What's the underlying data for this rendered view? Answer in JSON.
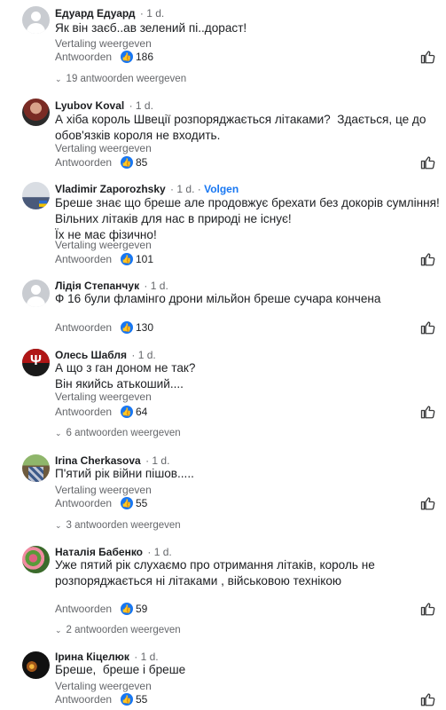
{
  "comments": [
    {
      "author": "Едуард Едуард",
      "time": "1 d.",
      "follow": "",
      "text": "Як він заєб..ав зелений пі..дораст!",
      "translate": "Vertaling weergeven",
      "reply": "Antwoorden",
      "likes": "186",
      "replies": "19 antwoorden weergeven"
    },
    {
      "author": "Lyubov Koval",
      "time": "1 d.",
      "follow": "",
      "text": "А хіба король Швеції розпоряджається літаками?  Здається, це до\nобов'язків короля не входить.",
      "translate": "Vertaling weergeven",
      "reply": "Antwoorden",
      "likes": "85",
      "replies": ""
    },
    {
      "author": "Vladimir  Zaporozhsky",
      "time": "1 d.",
      "follow": "Volgen",
      "text": "Бреше знає що бреше але продовжує брехати без докорів сумління!\nВільних літаків для нас в природі не існує!\nЇх не має фізично!",
      "translate": "Vertaling weergeven",
      "reply": "Antwoorden",
      "likes": "101",
      "replies": ""
    },
    {
      "author": "Лідія Степанчук",
      "time": "1 d.",
      "follow": "",
      "text": "Ф 16 були фламінго дрони мільйон бреше сучара кончена",
      "translate": "",
      "reply": "Antwoorden",
      "likes": "130",
      "replies": ""
    },
    {
      "author": "Олесь Шабля",
      "time": "1 d.",
      "follow": "",
      "text": "А що з ган доном не так?\nВін якийсь атькоший....",
      "translate": "Vertaling weergeven",
      "reply": "Antwoorden",
      "likes": "64",
      "replies": "6 antwoorden weergeven"
    },
    {
      "author": "Irina Cherkasova",
      "time": "1 d.",
      "follow": "",
      "text": "П'ятий рік війни пішов.....",
      "translate": "Vertaling weergeven",
      "reply": "Antwoorden",
      "likes": "55",
      "replies": "3 antwoorden weergeven"
    },
    {
      "author": "Наталія Бабенко",
      "time": "1 d.",
      "follow": "",
      "text": "Уже пятий рік слухаємо про отримання літаків, король не\nрозпоряджається ні літаками , військовою технікою",
      "translate": "",
      "reply": "Antwoorden",
      "likes": "59",
      "replies": "2 antwoorden weergeven"
    },
    {
      "author": "Ірина Кіцелюк",
      "time": "1 d.",
      "follow": "",
      "text": "Бреше,  бреше і бреше",
      "translate": "Vertaling weergeven",
      "reply": "Antwoorden",
      "likes": "55",
      "replies": ""
    }
  ],
  "icons": {
    "like_badge": "like-thumb-icon",
    "like_action": "thumb-up-outline-icon",
    "replies_chevron": "chevron-down-icon"
  },
  "colors": {
    "accent": "#1877f2",
    "secondary_text": "#65676b"
  }
}
